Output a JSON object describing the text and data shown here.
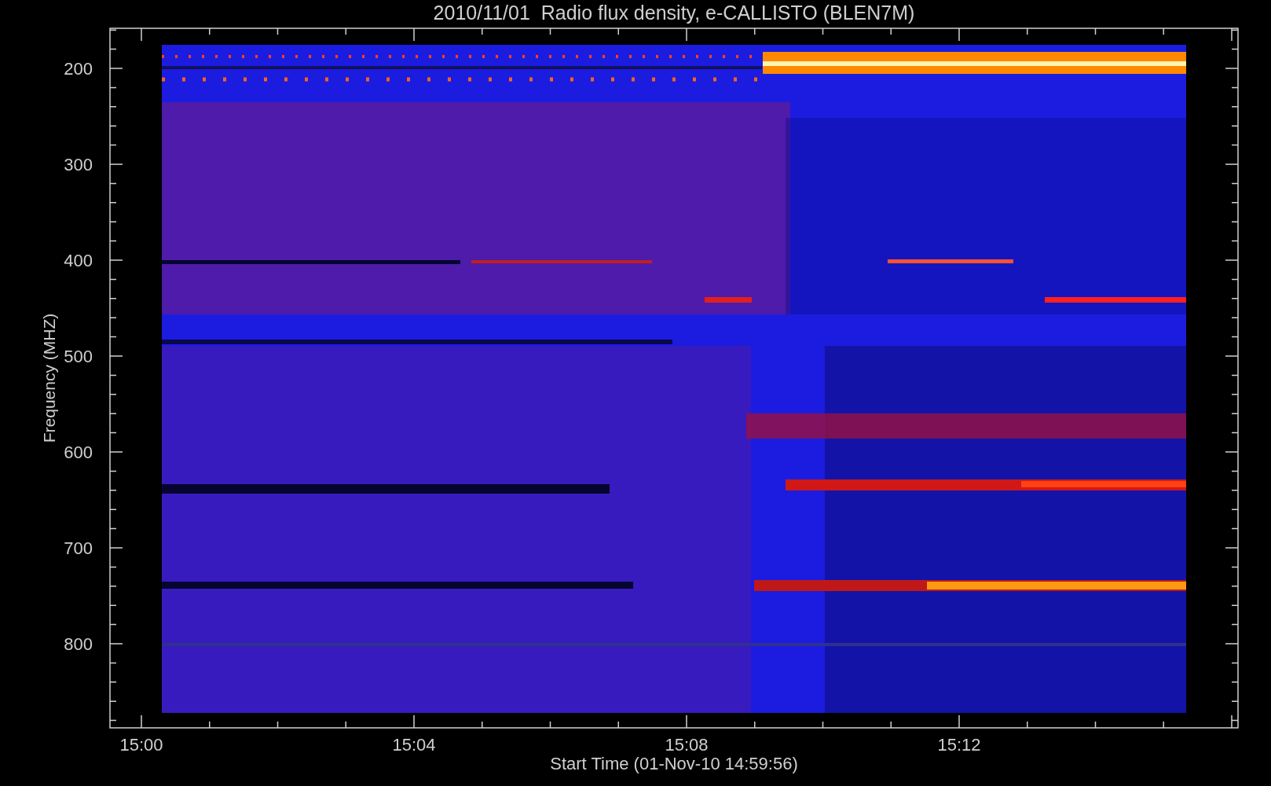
{
  "plot": {
    "title": "2010/11/01  Radio flux density, e-CALLISTO (BLEN7M)",
    "ylabel": "Frequency (MHZ)",
    "xlabel": "Start Time (01-Nov-10 14:59:56)",
    "yticks": [
      "200",
      "300",
      "400",
      "500",
      "600",
      "700",
      "800"
    ],
    "xticks": [
      "15:00",
      "15:04",
      "15:08",
      "15:12"
    ]
  }
}
